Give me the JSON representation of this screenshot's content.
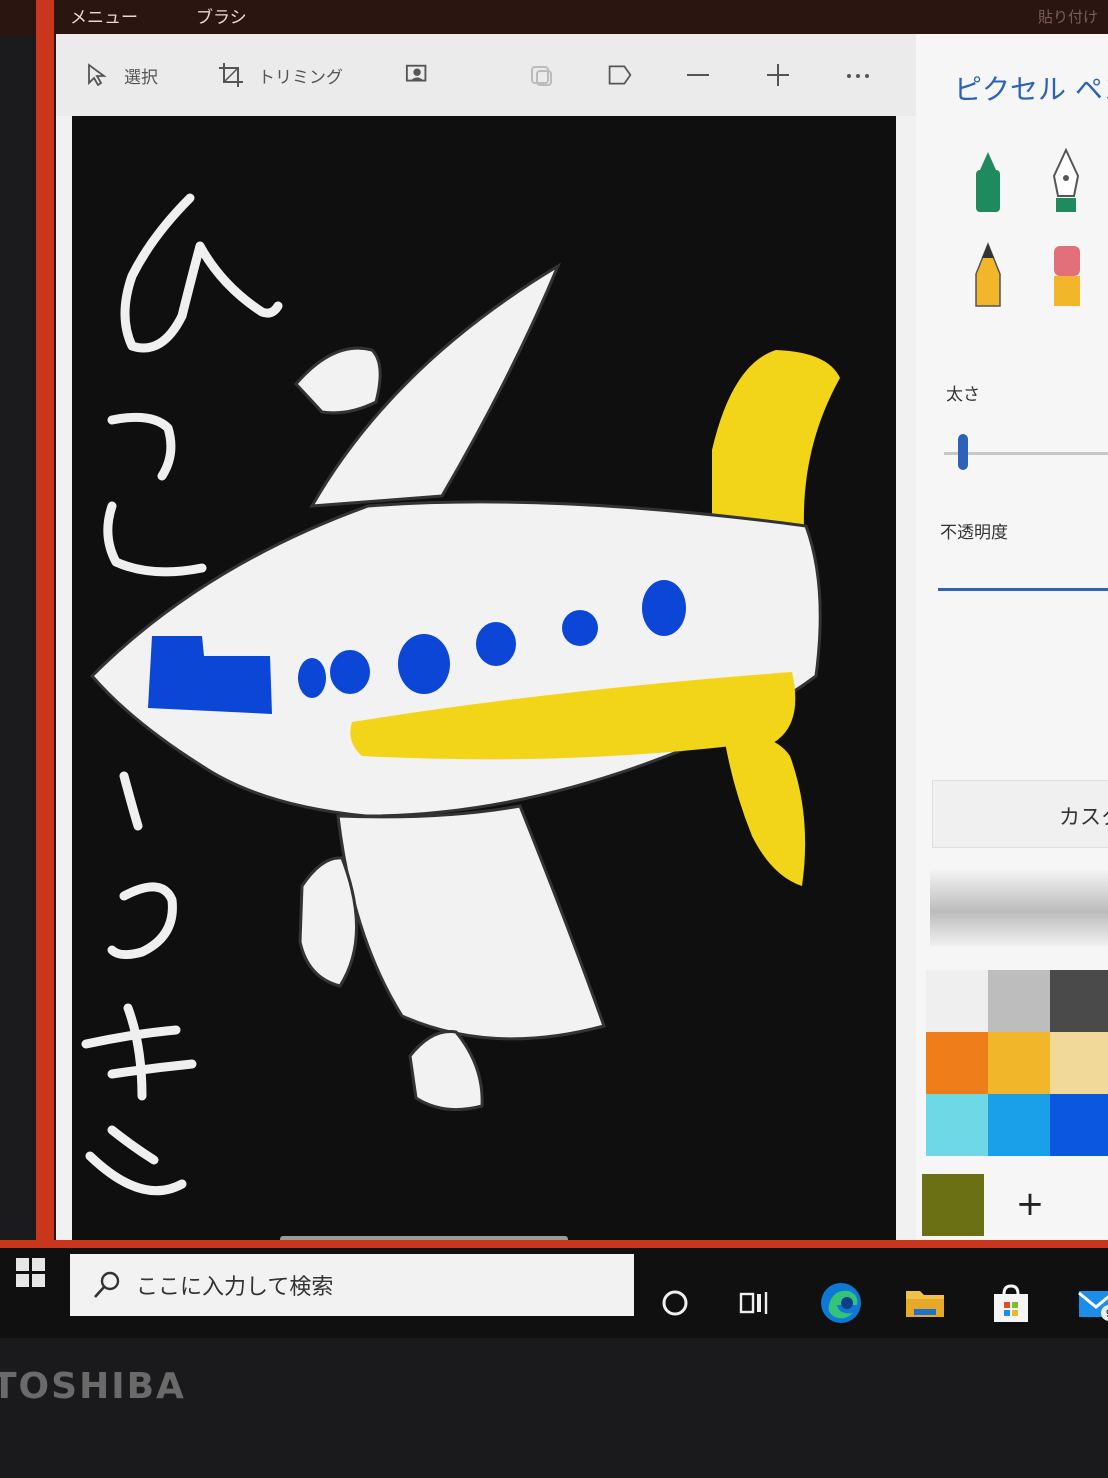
{
  "menubar": {
    "menu": "メニュー",
    "brush": "ブラシ",
    "right_hint": "貼り付け"
  },
  "toolbar": {
    "select": "選択",
    "crop": "トリミング",
    "icons": [
      "cursor-icon",
      "crop-icon",
      "magic-select-icon",
      "sticker-icon",
      "copy-icon",
      "zoom-out-icon",
      "zoom-in-icon",
      "more-icon"
    ]
  },
  "canvas": {
    "text_left_top": "ひつこ",
    "text_left_bottom": "うき",
    "colors": {
      "background": "#0f0f10",
      "plane": "#f2f2f2",
      "windows": "#0b46d6",
      "stripe": "#f2d419"
    }
  },
  "panel": {
    "title": "ピクセル ペン",
    "thickness_label": "太さ",
    "opacity_label": "不透明度",
    "custom_label": "カスタ",
    "thickness": 0.1,
    "opacity": 1.0,
    "tools": [
      "marker-icon",
      "calligraphy-pen-icon",
      "pencil-icon",
      "eraser-icon"
    ],
    "swatches": [
      "#efefef",
      "#bdbdbd",
      "#4a4a4a",
      "#ee7d1a",
      "#f2b62a",
      "#f1d99a",
      "#6fd8e6",
      "#1aa0e8",
      "#0b57e0"
    ],
    "custom_swatch": "#6b7015",
    "add_label": "+"
  },
  "taskbar": {
    "search_placeholder": "ここに入力して検索",
    "apps": [
      "cortana-icon",
      "task-view-icon",
      "edge-icon",
      "file-explorer-icon",
      "store-icon",
      "mail-icon"
    ],
    "mail_badge": "9"
  },
  "device": {
    "brand": "TOSHIBA"
  }
}
